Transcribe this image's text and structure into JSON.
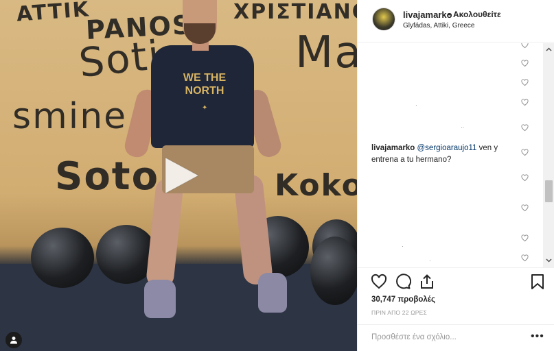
{
  "post": {
    "media": {
      "wall_texts": [
        "PANOS",
        "Soti",
        "smine",
        "Soto",
        "Ma",
        "Koko",
        "ATTIK",
        "ΧΡΙΣΤΙΑΝΟ"
      ],
      "shirt_text": "WE THE NORTH"
    },
    "header": {
      "username": "livajamarko",
      "separator": "•",
      "follow_label": "Ακολουθείτε",
      "location": "Glyfádas, Attiki, Greece"
    },
    "comment": {
      "username": "livajamarko",
      "mention": "@sergioaraujo11",
      "text": " ven y entrena a tu hermano?"
    },
    "stats": {
      "views": "30,747 προβολές",
      "time": "ΠΡΙΝ ΑΠΟ 22 ΩΡΕΣ"
    },
    "add_comment": {
      "placeholder": "Προσθέστε ένα σχόλιο..."
    },
    "more_label": "•••"
  },
  "icons": {
    "like": "heart-icon",
    "comment": "comment-icon",
    "share": "share-icon",
    "save": "bookmark-icon",
    "play": "play-icon",
    "user_tag": "user-icon"
  }
}
